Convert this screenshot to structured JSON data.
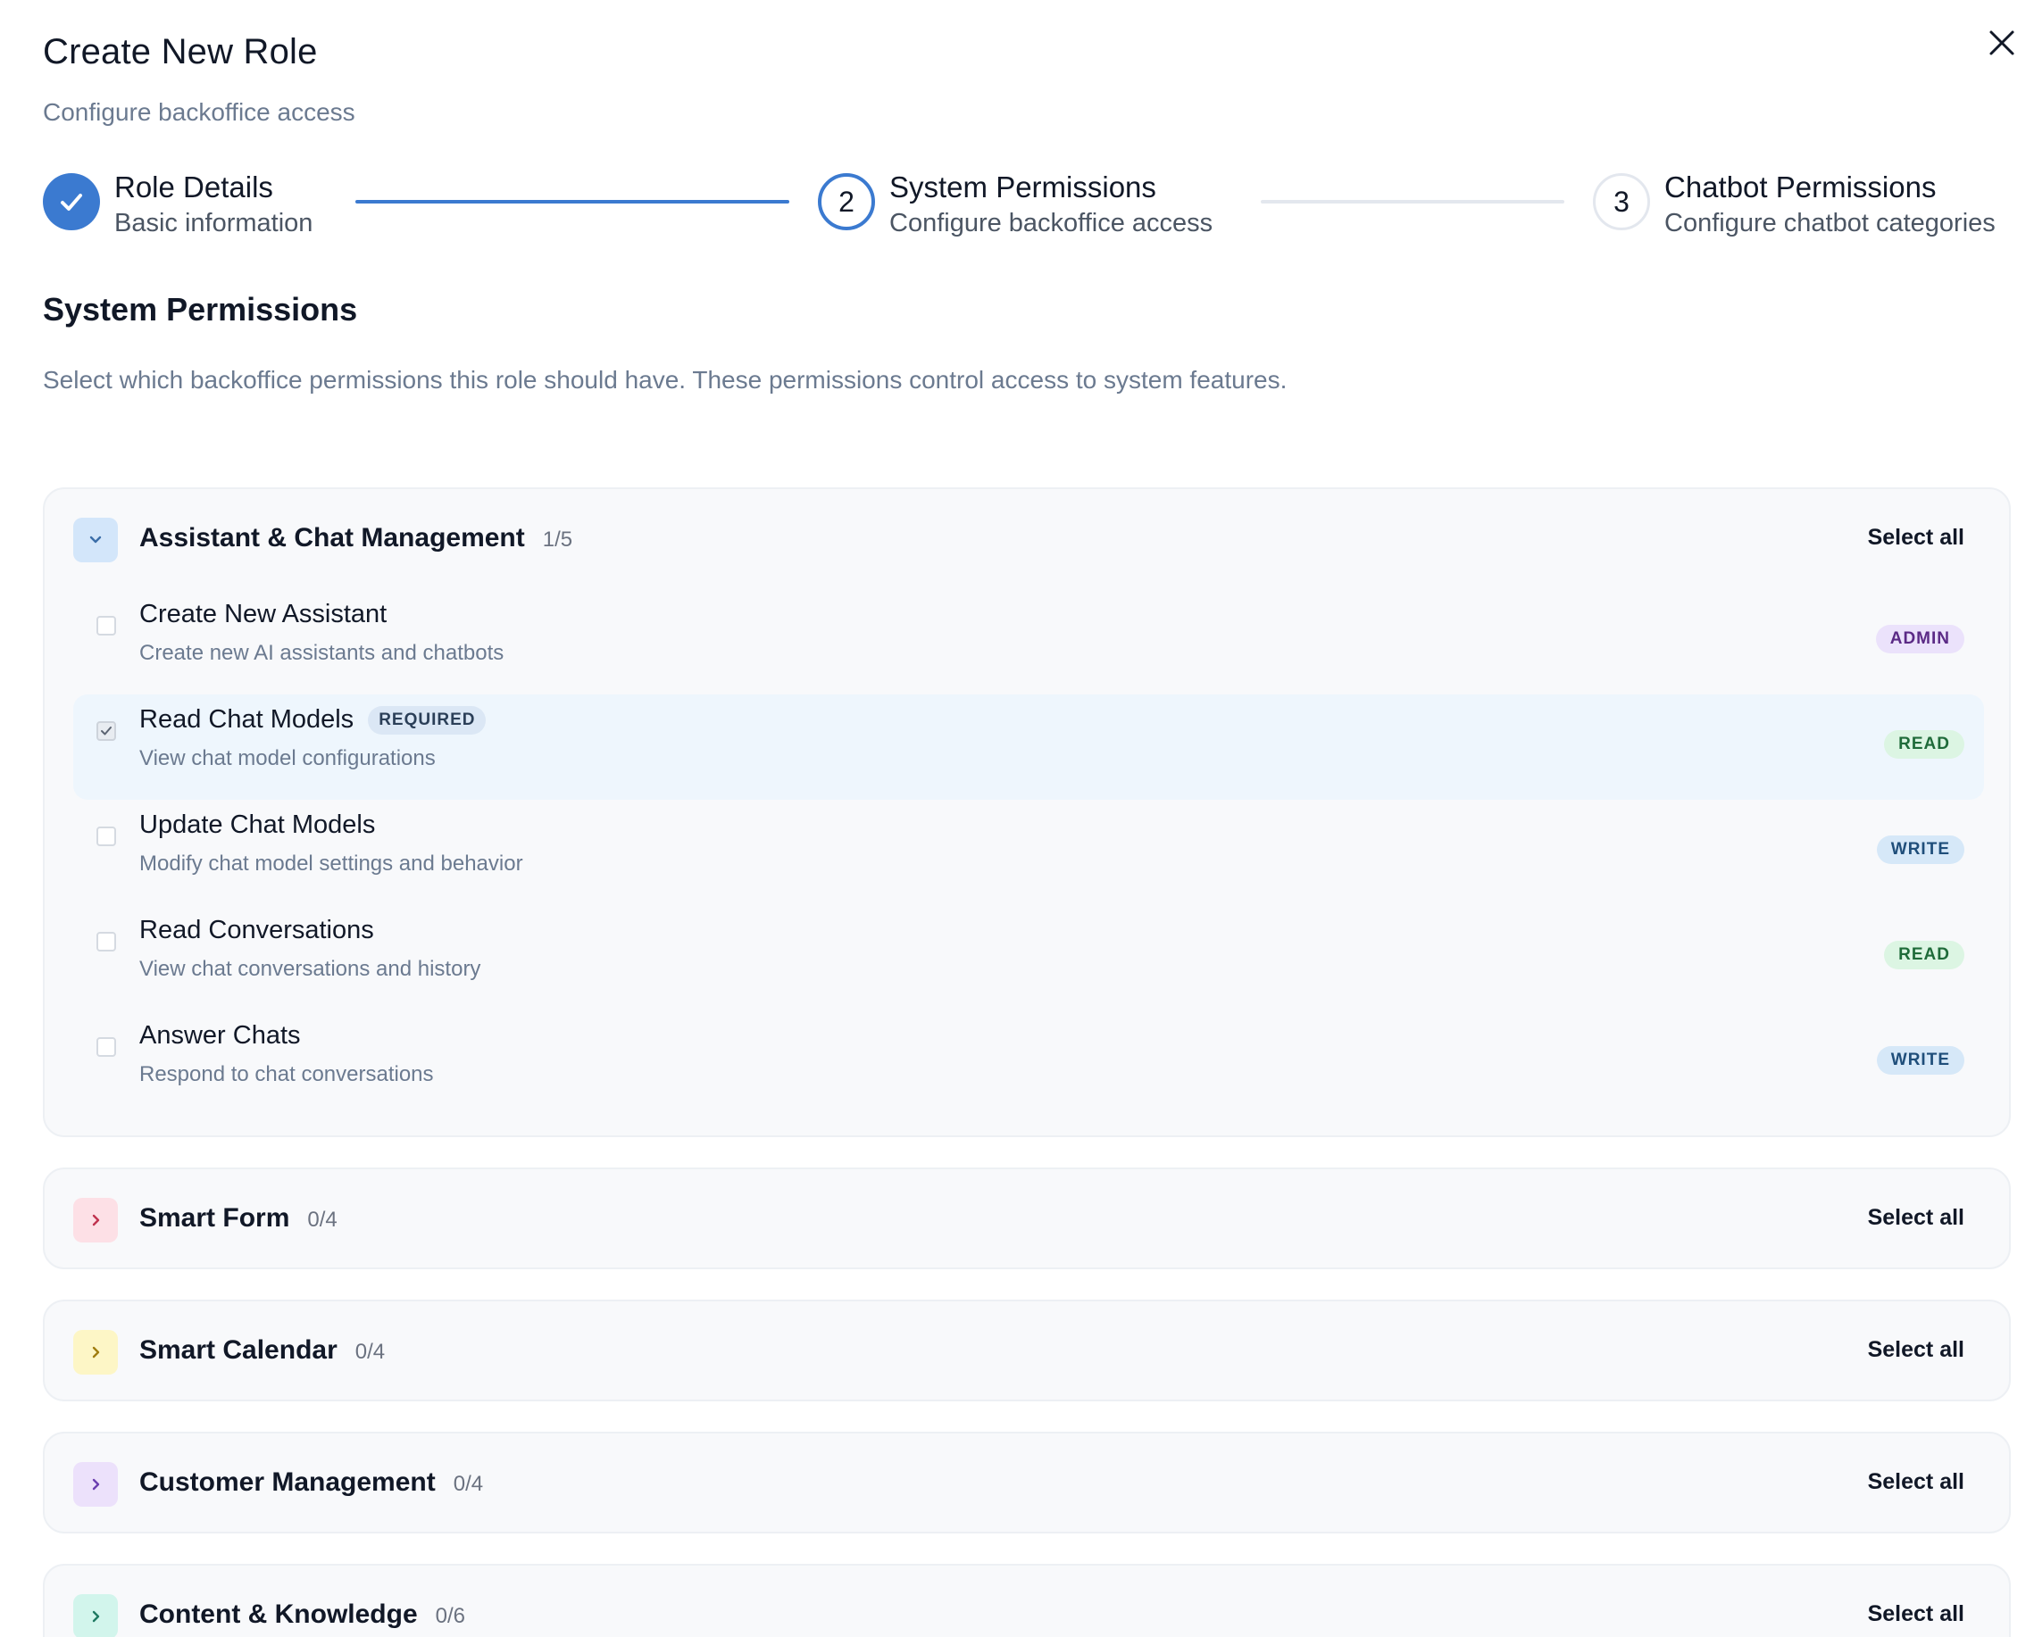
{
  "header": {
    "title": "Create New Role",
    "subtitle": "Configure backoffice access"
  },
  "stepper": {
    "steps": [
      {
        "number": "",
        "title": "Role Details",
        "desc": "Basic information",
        "state": "done"
      },
      {
        "number": "2",
        "title": "System Permissions",
        "desc": "Configure backoffice access",
        "state": "active"
      },
      {
        "number": "3",
        "title": "Chatbot Permissions",
        "desc": "Configure chatbot categories",
        "state": "todo"
      }
    ]
  },
  "section": {
    "title": "System Permissions",
    "desc": "Select which backoffice permissions this role should have. These permissions control access to system features."
  },
  "groups": [
    {
      "name": "Assistant & Chat Management",
      "count": "1/5",
      "select_all": "Select all",
      "color": "#d3e6fa",
      "icon_color": "#3b6ea8",
      "expanded": true,
      "items": [
        {
          "name": "Create New Assistant",
          "desc": "Create new AI assistants and chatbots",
          "badge": "ADMIN",
          "checked": false
        },
        {
          "name": "Read Chat Models",
          "required": "REQUIRED",
          "desc": "View chat model configurations",
          "badge": "READ",
          "checked": true
        },
        {
          "name": "Update Chat Models",
          "desc": "Modify chat model settings and behavior",
          "badge": "WRITE",
          "checked": false
        },
        {
          "name": "Read Conversations",
          "desc": "View chat conversations and history",
          "badge": "READ",
          "checked": false
        },
        {
          "name": "Answer Chats",
          "desc": "Respond to chat conversations",
          "badge": "WRITE",
          "checked": false
        }
      ]
    },
    {
      "name": "Smart Form",
      "count": "0/4",
      "select_all": "Select all",
      "color": "#fde0e6",
      "icon_color": "#c0334f",
      "expanded": false
    },
    {
      "name": "Smart Calendar",
      "count": "0/4",
      "select_all": "Select all",
      "color": "#fdf6c6",
      "icon_color": "#a07d10",
      "expanded": false
    },
    {
      "name": "Customer Management",
      "count": "0/4",
      "select_all": "Select all",
      "color": "#ece1fb",
      "icon_color": "#6b3fb0",
      "expanded": false
    },
    {
      "name": "Content & Knowledge",
      "count": "0/6",
      "select_all": "Select all",
      "color": "#d2f5ec",
      "icon_color": "#1f7a62",
      "expanded": false
    }
  ]
}
